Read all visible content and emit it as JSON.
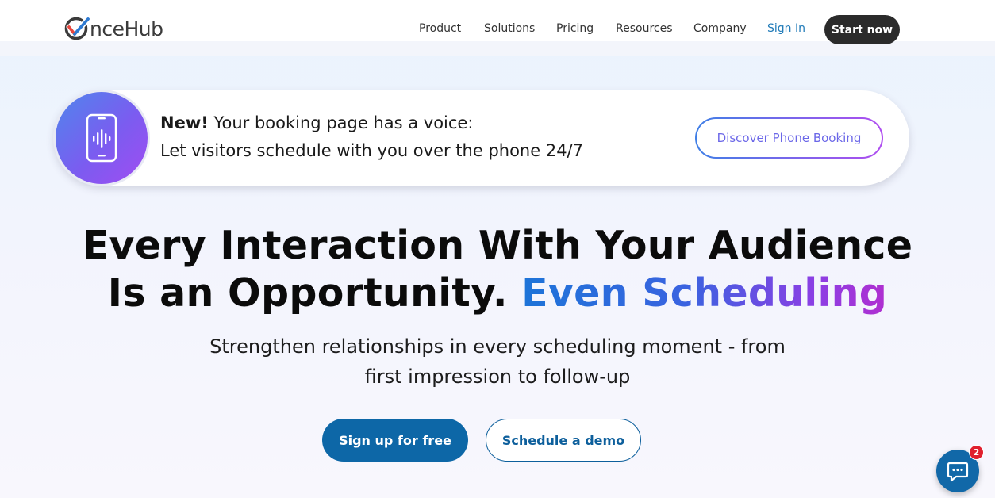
{
  "header": {
    "logo_text": "nceHub",
    "logo_alt": "OnceHub",
    "nav": [
      {
        "label": "Product"
      },
      {
        "label": "Solutions"
      },
      {
        "label": "Pricing"
      },
      {
        "label": "Resources"
      },
      {
        "label": "Company"
      },
      {
        "label": "Sign In"
      }
    ],
    "start_label": "Start now"
  },
  "banner": {
    "new_label": "New!",
    "line1_rest": " Your booking page has a voice:",
    "line2": "Let visitors schedule with you over the phone 24/7",
    "button_label": "Discover Phone Booking",
    "icon": "phone-voice-icon"
  },
  "hero": {
    "line1": "Every Interaction With Your Audience",
    "line2_plain": "Is an Opportunity.",
    "line2_highlight": "Even Scheduling"
  },
  "subtitle": {
    "line1": "Strengthen relationships in every scheduling moment - from",
    "line2": "first impression to follow-up"
  },
  "cta": {
    "primary_label": "Sign up for free",
    "secondary_label": "Schedule a demo"
  },
  "chat": {
    "icon": "chat-bubble-icon",
    "badge_count": "2"
  },
  "colors": {
    "brand_blue": "#0d67a7",
    "dark_button": "#2b2b2b",
    "gradient_start": "#1d74d8",
    "gradient_end": "#b02fd0",
    "badge_red": "#e0202e"
  }
}
